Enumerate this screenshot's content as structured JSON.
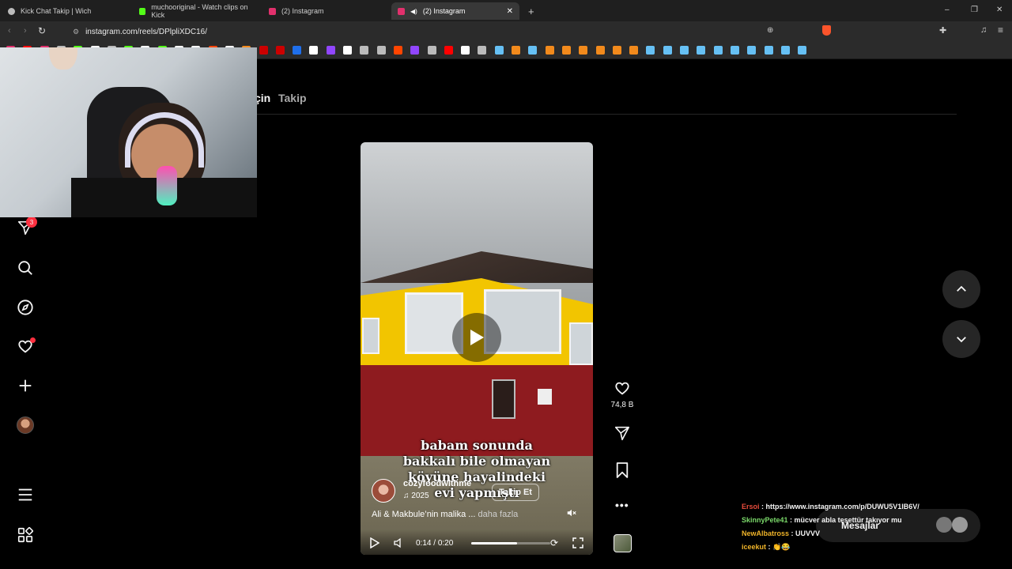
{
  "browser": {
    "tabs": [
      {
        "title": "Kick Chat Takip | Wich",
        "color": "#bbbbbb"
      },
      {
        "title": "muchooriginal - Watch clips on Kick",
        "color": "#53fc18"
      },
      {
        "title": "(2) Instagram",
        "color": "#e1306c"
      },
      {
        "title": "(2) Instagram",
        "color": "#e1306c",
        "active": true
      }
    ],
    "new_tab_symbol": "+",
    "url": "instagram.com/reels/DPlpliXDC16/",
    "window_controls": [
      "–",
      "❐",
      "✕"
    ]
  },
  "header": {
    "tab_partial": "çin",
    "tab_follow": "Takip"
  },
  "sidebar": {
    "notifications_badge": "3"
  },
  "reel": {
    "overlay_text": [
      "babam sonunda",
      "bakkalı bile olmayan",
      "köyüne hayalindeki",
      "evi yapmıştı"
    ],
    "username": "cozyfoodwithme",
    "follow_label": "Takip Et",
    "audio": "♫",
    "audio_text": "2025 ",
    "caption": "Ali & Makbule’nin malika ...",
    "caption_more": "daha fazla",
    "time_current": "0:14",
    "time_separator": "/",
    "time_total": "0:20",
    "progress": 0.58
  },
  "actions": {
    "likes": "74,8 B"
  },
  "chat": [
    {
      "user": "Ersoi",
      "message": ": https://www.instagram.com/p/DUWU5V1IB6V/",
      "color": "#e74c3c"
    },
    {
      "user": "SkinnyPete41",
      "message": ": mücver abla tesettür takıyor mu",
      "color": "#7bd96a"
    },
    {
      "user": "NewAlbatross",
      "message": ": UUVVV",
      "color": "#f0b429"
    },
    {
      "user": "iceekut",
      "message": ": 👏😂",
      "color": "#ffffff"
    }
  ],
  "messages_popup": {
    "label": "Mesajlar"
  },
  "colors": {
    "accent_red": "#ff3040",
    "house_yellow": "#f2c500",
    "house_red": "#8e1b1f"
  }
}
